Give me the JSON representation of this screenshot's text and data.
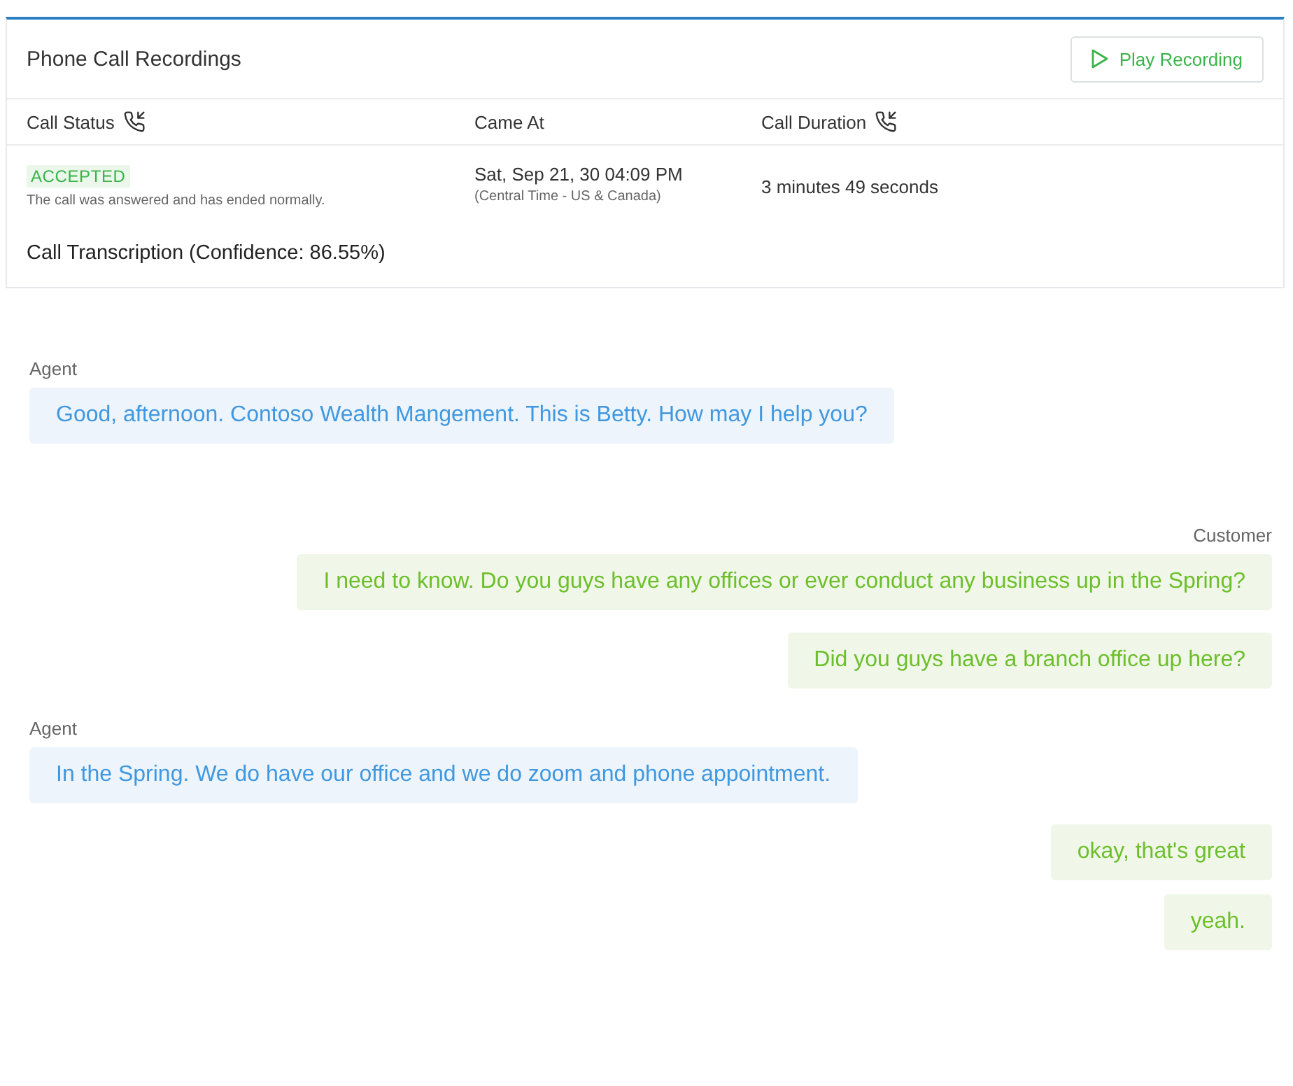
{
  "card": {
    "title": "Phone Call Recordings",
    "play_button": "Play Recording",
    "columns": [
      {
        "label": "Call Status",
        "phone_icon": true
      },
      {
        "label": "Came At",
        "phone_icon": false
      },
      {
        "label": "Call Duration",
        "phone_icon": true
      }
    ],
    "status": {
      "badge": "ACCEPTED",
      "note": "The call was answered and has ended normally."
    },
    "came_at": {
      "date": "Sat, Sep 21, 30 04:09 PM",
      "zone": "(Central Time - US & Canada)"
    },
    "duration": "3 minutes 49 seconds",
    "transcription_title": "Call Transcription (Confidence: 86.55%)"
  },
  "transcript": [
    {
      "kind": "agent",
      "speaker": "Agent",
      "messages": [
        "Good, afternoon. Contoso Wealth Mangement. This is Betty. How may I help you?"
      ]
    },
    {
      "kind": "customer",
      "speaker": "Customer",
      "messages": [
        "I need to know. Do you guys have any offices or ever conduct any business up in the Spring?",
        "Did you guys have a branch office up here?"
      ]
    },
    {
      "kind": "agent",
      "speaker": "Agent",
      "messages": [
        "In the Spring. We do have our office and we do zoom and phone appointment."
      ]
    },
    {
      "kind": "customer",
      "messages": [
        "okay, that's great",
        "yeah."
      ]
    }
  ]
}
